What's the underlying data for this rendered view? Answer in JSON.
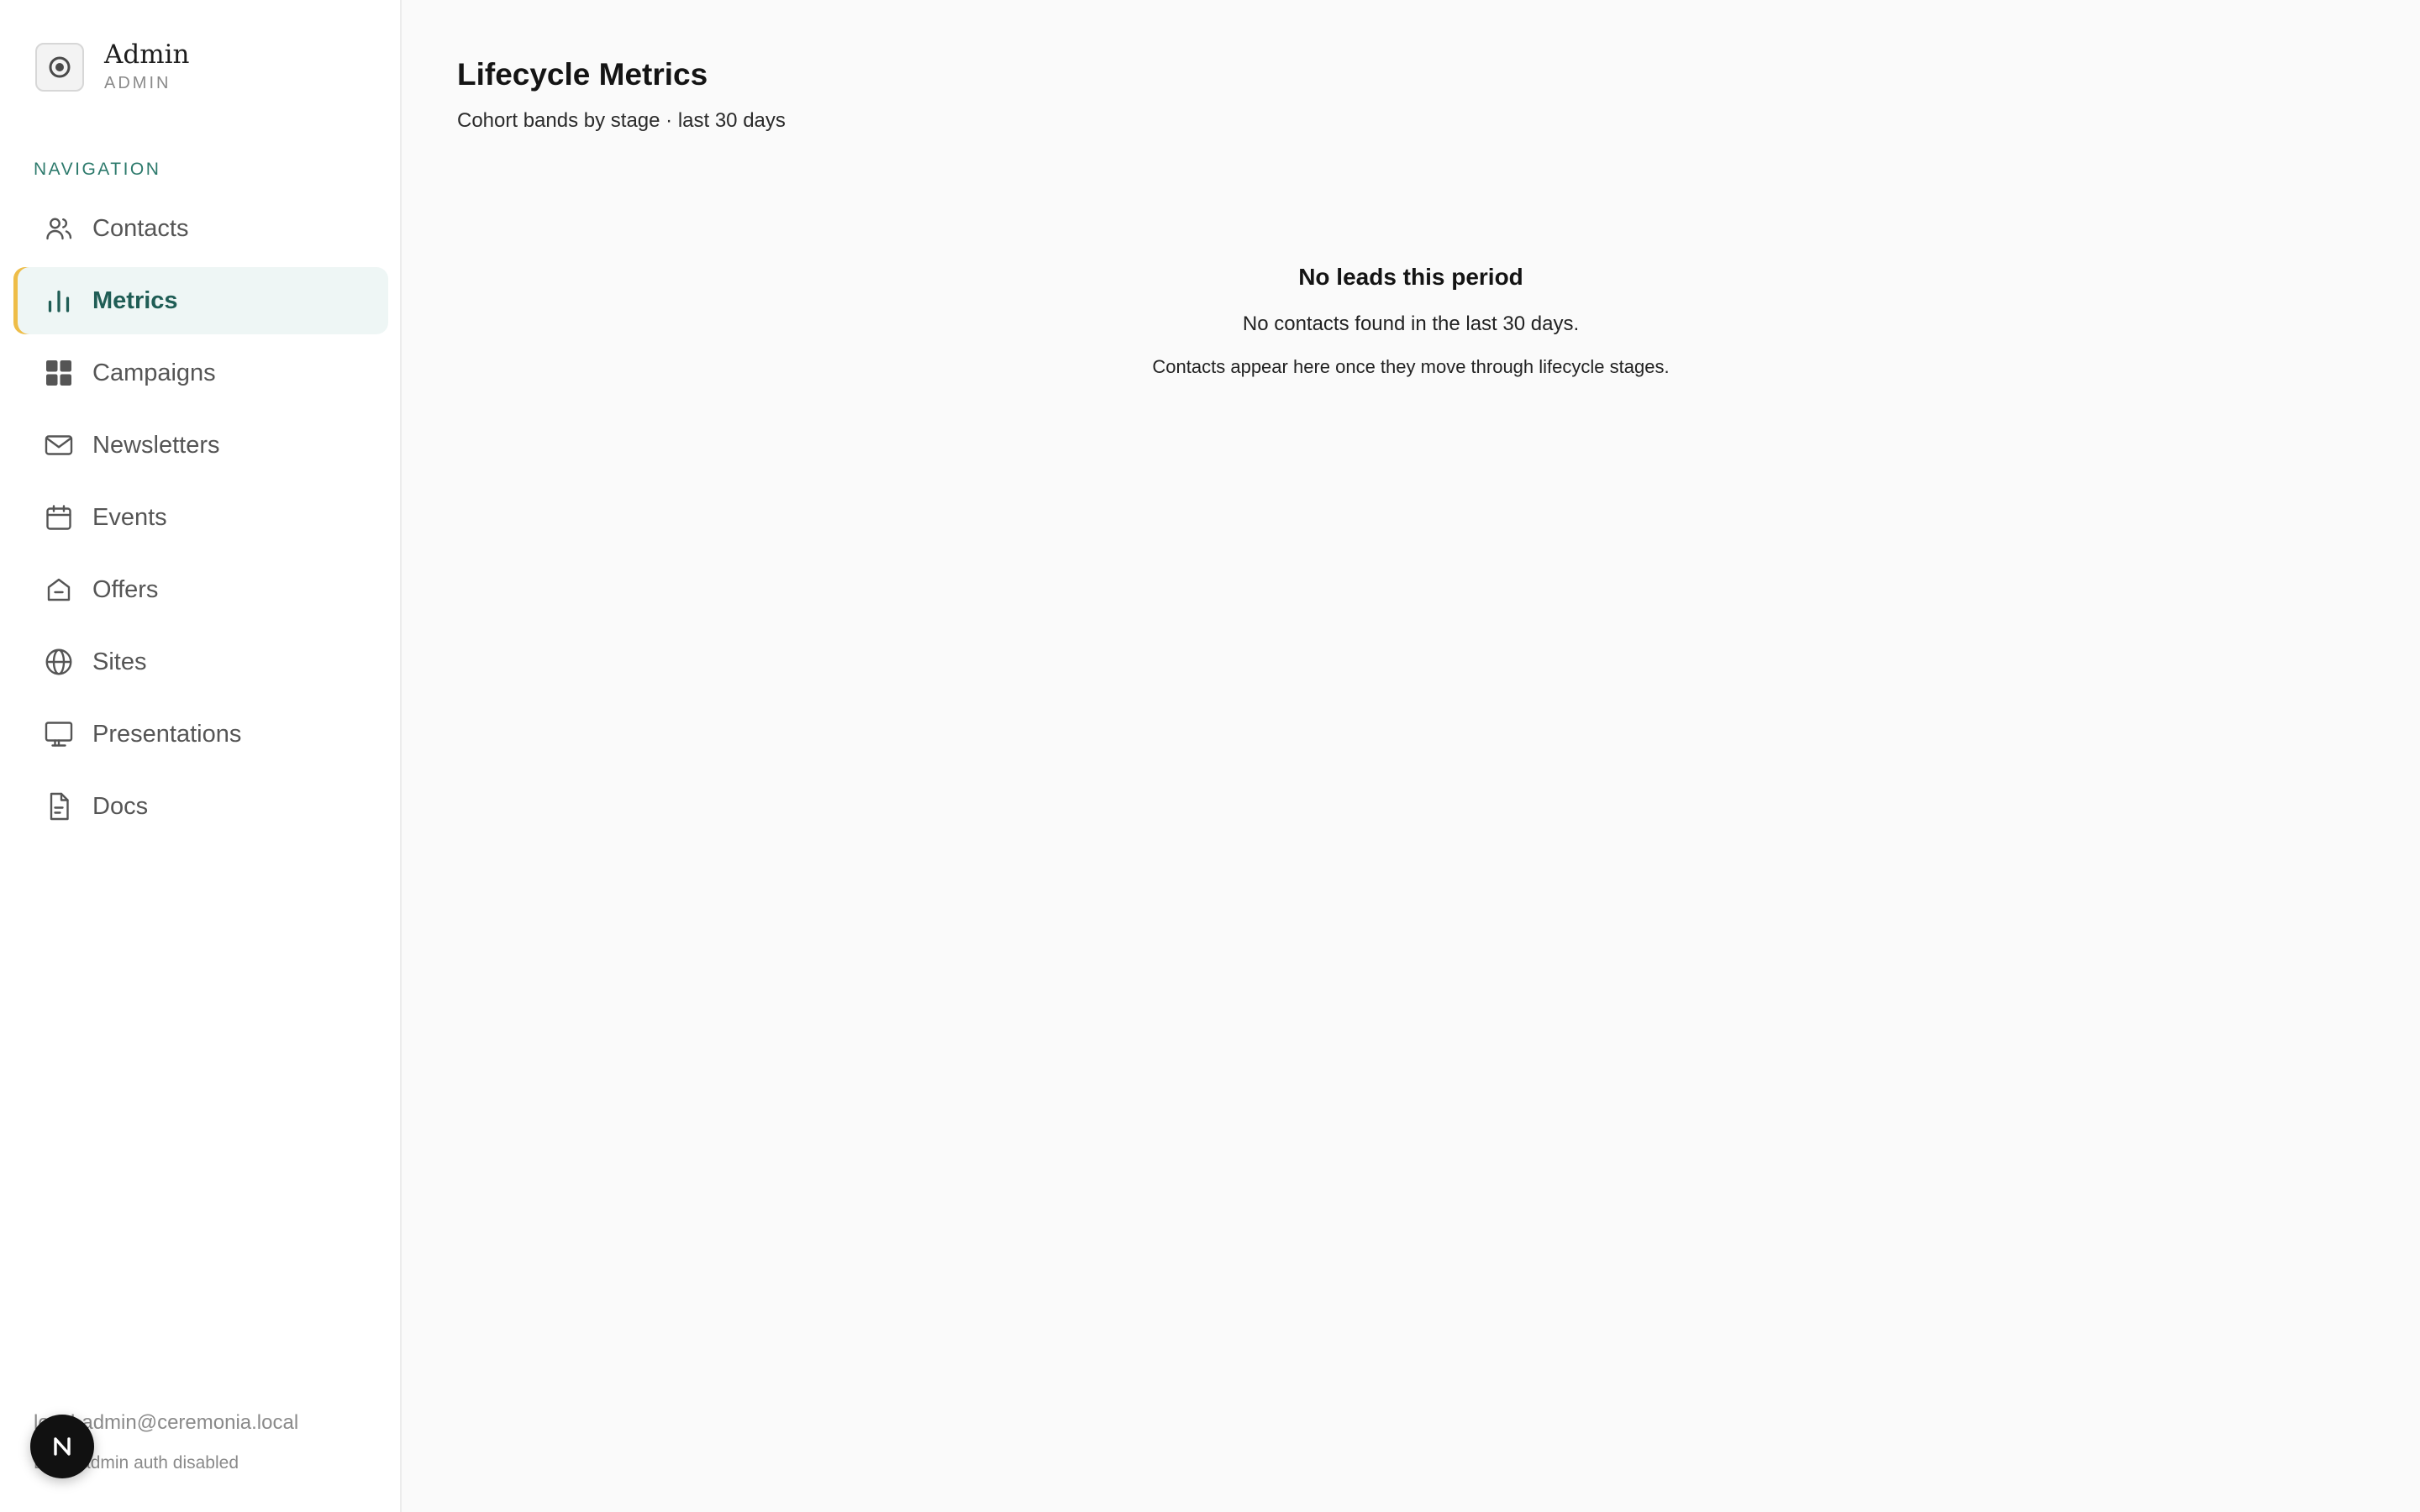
{
  "brand": {
    "title": "Admin",
    "subtitle": "ADMIN"
  },
  "sidebar": {
    "heading": "NAVIGATION",
    "items": [
      {
        "label": "Contacts",
        "icon": "users-icon",
        "active": false
      },
      {
        "label": "Metrics",
        "icon": "bar-chart-icon",
        "active": true
      },
      {
        "label": "Campaigns",
        "icon": "grid-icon",
        "active": false
      },
      {
        "label": "Newsletters",
        "icon": "mail-icon",
        "active": false
      },
      {
        "label": "Events",
        "icon": "calendar-icon",
        "active": false
      },
      {
        "label": "Offers",
        "icon": "tag-icon",
        "active": false
      },
      {
        "label": "Sites",
        "icon": "globe-icon",
        "active": false
      },
      {
        "label": "Presentations",
        "icon": "monitor-icon",
        "active": false
      },
      {
        "label": "Docs",
        "icon": "document-icon",
        "active": false
      }
    ],
    "footer": {
      "email": "local-admin@ceremonia.local",
      "note": "Local admin auth disabled"
    }
  },
  "badge": {
    "letter": "N"
  },
  "main": {
    "title": "Lifecycle Metrics",
    "subtitle": "Cohort bands by stage · last 30 days",
    "empty_state": {
      "title": "No leads this period",
      "message": "No contacts found in the last 30 days.",
      "hint": "Contacts appear here once they move through lifecycle stages."
    }
  },
  "colors": {
    "accent": "#2d7a6c",
    "active_bg": "#eef6f5",
    "active_marker": "#eebd48",
    "page_bg": "#fafafa"
  }
}
